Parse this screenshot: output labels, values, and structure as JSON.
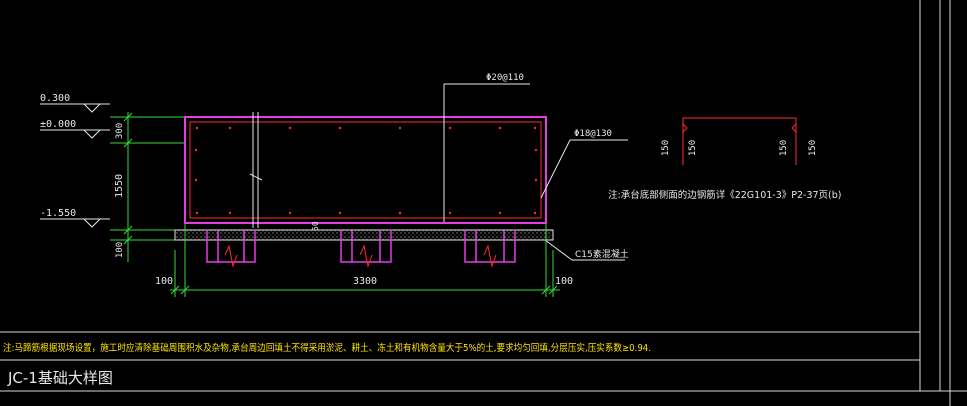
{
  "elevations": {
    "top": "0.300",
    "ground": "±0.000",
    "bottom": "-1.550"
  },
  "dimensions": {
    "v_300": "300",
    "v_1550": "1550",
    "v_100": "100",
    "h_left_100": "100",
    "h_3300": "3300",
    "h_right_100": "100",
    "small_50": "50",
    "detail_left_150a": "150",
    "detail_left_150b": "150",
    "detail_right_150a": "150",
    "detail_right_150b": "150"
  },
  "rebar": {
    "top_label": "Φ20@110",
    "side_label": "Φ18@130"
  },
  "labels": {
    "concrete_base": "C15素混凝土",
    "detail_note": "注:承台底部侧面的边钢筋详《22G101-3》P2-37页(b)",
    "bottom_note": "注:马蹄筋根据现场设置，施工时应清除基础周围积水及杂物,承台周边回填土不得采用淤泥、耕土、冻土和有机物含量大于5%的土,要求均匀回填,分层压实,压实系数≥0.94.",
    "title": "JC-1基础大样图"
  },
  "colors": {
    "background": "#000000",
    "frame": "#d8d8d8",
    "magenta": "#e23ee2",
    "red": "#ff2a2a",
    "green": "#33dd33",
    "white": "#e8e8e8",
    "yellow": "#ffe300"
  }
}
